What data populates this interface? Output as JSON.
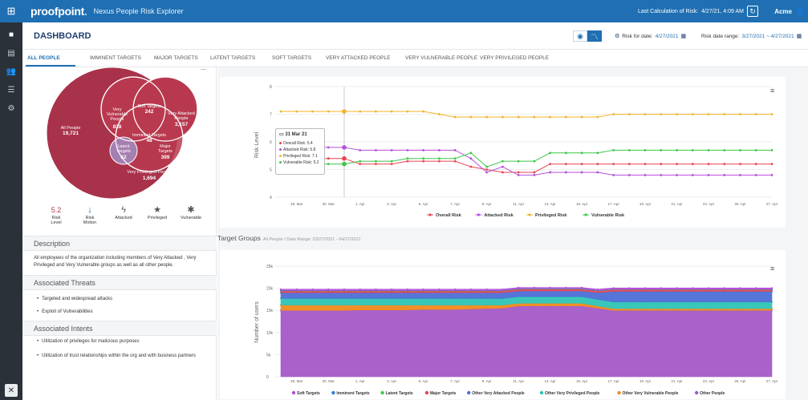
{
  "topbar": {
    "brand": "proofpoint",
    "app_title": "Nexus People Risk Explorer",
    "last_calc": "Last Calculation of Risk:",
    "last_calc_value": "4/27/21, 4:09 AM",
    "org": "Acme"
  },
  "header": {
    "title": "DASHBOARD",
    "risk_for_label": "Risk for date:",
    "risk_for_value": "4/27/2021",
    "risk_range_label": "Risk date range:",
    "risk_range_value": "3/27/2021 ~ 4/27/2021"
  },
  "tabs": [
    {
      "label": "ALL PEOPLE"
    },
    {
      "label": "IMMINENT TARGETS"
    },
    {
      "label": "MAJOR TARGETS"
    },
    {
      "label": "LATENT TARGETS"
    },
    {
      "label": "SOFT TARGETS"
    },
    {
      "label": "VERY ATTACKED PEOPLE"
    },
    {
      "label": "VERY VULNERABLE PEOPLE"
    },
    {
      "label": "VERY PRIVILEGED PEOPLE"
    }
  ],
  "venn": {
    "all": {
      "label": "All People",
      "value": "19,721"
    },
    "soft": {
      "label": "Soft Targets",
      "value": "242"
    },
    "vulnerable": {
      "label": "Very Vulnerable People",
      "value": "838"
    },
    "attacked": {
      "label": "Very Attacked People",
      "value": "3,157"
    },
    "imminent": {
      "label": "Imminent Targets",
      "value": "48"
    },
    "latent": {
      "label": "Latent Targets",
      "value": "62"
    },
    "major": {
      "label": "Major Targets",
      "value": "399"
    },
    "privileged": {
      "label": "Very Privileged People",
      "value": "1,694"
    }
  },
  "legend": {
    "risk_level_value": "5.2",
    "risk_level": "Risk Level",
    "risk_motion": "Risk Motion",
    "attacked": "Attacked",
    "privileged": "Privileged",
    "vulnerable": "Vulnerable"
  },
  "description": {
    "title": "Description",
    "text": "All employees of the organization including members of Very Attacked , Very Privileged and Very Vulnerable groups as well as all other people."
  },
  "threats": {
    "title": "Associated Threats",
    "items": [
      "Targeted and widespread attacks",
      "Exploit of Vulnerabilities"
    ]
  },
  "intents": {
    "title": "Associated Intents",
    "items": [
      "Utilization of privileges for malicious purposes",
      "Utilization of trust relationships within the org and with business partners"
    ]
  },
  "tooltip": {
    "date": "31 Mar 21",
    "rows": [
      "Overall Risk: 5.4",
      "Attacked Risk: 5.8",
      "Privileged Risk: 7.1",
      "Vulnerable Risk: 5.2"
    ]
  },
  "target_groups": {
    "title": "Target Groups",
    "subtitle": "All People / Date Range: 03/27/2021 - 04/27/2021"
  },
  "colors": {
    "overall": "#e84552",
    "attacked": "#b54fdb",
    "privileged": "#f0b429",
    "vulnerable": "#3ec74a",
    "brand": "#1f6fb2"
  },
  "chart_data": [
    {
      "type": "line",
      "title": "",
      "xlabel": "",
      "ylabel": "Risk Level",
      "ylim": [
        4,
        8
      ],
      "yticks": [
        4,
        5,
        6,
        7,
        8
      ],
      "xtick_labels": [
        "28. Mar",
        "30. Mar",
        "1. Apr",
        "3. Apr",
        "5. Apr",
        "7. Apr",
        "9. Apr",
        "11. Apr",
        "13. Apr",
        "15. Apr",
        "17. Apr",
        "19. Apr",
        "21. Apr",
        "23. Apr",
        "25. Apr",
        "27. Apr"
      ],
      "x": [
        "27. Mar",
        "28. Mar",
        "29. Mar",
        "30. Mar",
        "31. Mar",
        "1. Apr",
        "2. Apr",
        "3. Apr",
        "4. Apr",
        "5. Apr",
        "6. Apr",
        "7. Apr",
        "8. Apr",
        "9. Apr",
        "10. Apr",
        "11. Apr",
        "12. Apr",
        "13. Apr",
        "14. Apr",
        "15. Apr",
        "16. Apr",
        "17. Apr",
        "18. Apr",
        "19. Apr",
        "20. Apr",
        "21. Apr",
        "22. Apr",
        "23. Apr",
        "24. Apr",
        "25. Apr",
        "26. Apr",
        "27. Apr"
      ],
      "series": [
        {
          "name": "Overall Risk",
          "values": [
            5.4,
            5.4,
            5.4,
            5.4,
            5.4,
            5.2,
            5.2,
            5.2,
            5.3,
            5.3,
            5.3,
            5.3,
            5.1,
            5.0,
            4.9,
            4.9,
            4.9,
            5.2,
            5.2,
            5.2,
            5.2,
            5.2,
            5.2,
            5.2,
            5.2,
            5.2,
            5.2,
            5.2,
            5.2,
            5.2,
            5.2,
            5.2
          ]
        },
        {
          "name": "Attacked Risk",
          "values": [
            5.8,
            5.8,
            5.8,
            5.8,
            5.8,
            5.7,
            5.7,
            5.7,
            5.7,
            5.7,
            5.7,
            5.7,
            5.4,
            4.9,
            5.1,
            4.8,
            4.8,
            4.9,
            4.9,
            4.9,
            4.9,
            4.8,
            4.8,
            4.8,
            4.8,
            4.8,
            4.8,
            4.8,
            4.8,
            4.8,
            4.8,
            4.8
          ]
        },
        {
          "name": "Privileged Risk",
          "values": [
            7.1,
            7.1,
            7.1,
            7.1,
            7.1,
            7.1,
            7.1,
            7.1,
            7.1,
            7.1,
            7.0,
            6.9,
            6.9,
            6.9,
            6.9,
            6.9,
            6.9,
            6.9,
            6.9,
            6.9,
            6.9,
            7.0,
            7.0,
            7.0,
            7.0,
            7.0,
            7.0,
            7.0,
            7.0,
            7.0,
            7.0,
            7.0
          ]
        },
        {
          "name": "Vulnerable Risk",
          "values": [
            5.2,
            5.2,
            5.2,
            5.2,
            5.2,
            5.3,
            5.3,
            5.3,
            5.4,
            5.4,
            5.4,
            5.4,
            5.6,
            5.1,
            5.3,
            5.3,
            5.3,
            5.6,
            5.6,
            5.6,
            5.6,
            5.7,
            5.7,
            5.7,
            5.7,
            5.7,
            5.7,
            5.7,
            5.7,
            5.7,
            5.7,
            5.7
          ]
        }
      ]
    },
    {
      "type": "area",
      "title": "",
      "xlabel": "",
      "ylabel": "Number of users",
      "ylim": [
        0,
        25000
      ],
      "ytick_labels": [
        "0",
        "5k",
        "10k",
        "15k",
        "20k",
        "25k"
      ],
      "xtick_labels": [
        "28. Mar",
        "30. Mar",
        "1. Apr",
        "3. Apr",
        "5. Apr",
        "7. Apr",
        "9. Apr",
        "11. Apr",
        "13. Apr",
        "15. Apr",
        "17. Apr",
        "19. Apr",
        "21. Apr",
        "23. Apr",
        "25. Apr",
        "27. Apr"
      ],
      "x_count": 32,
      "series": [
        {
          "name": "Other People",
          "values": [
            15000,
            15000,
            15000,
            15000,
            15000,
            15100,
            15100,
            15100,
            15100,
            15200,
            15200,
            15200,
            15300,
            15400,
            15500,
            16000,
            16000,
            16000,
            16000,
            16000,
            15500,
            15000,
            15000,
            15000,
            15000,
            15000,
            15000,
            15000,
            15000,
            15000,
            15000,
            15000
          ]
        },
        {
          "name": "Other Very Vulnerable People",
          "values": [
            1200,
            1200,
            1200,
            1200,
            1200,
            1100,
            1100,
            1100,
            1100,
            1000,
            1000,
            1000,
            900,
            800,
            700,
            600,
            600,
            600,
            600,
            600,
            500,
            400,
            400,
            400,
            400,
            400,
            400,
            400,
            400,
            400,
            400,
            400
          ]
        },
        {
          "name": "Other Very Privileged People",
          "values": [
            1500,
            1500,
            1500,
            1500,
            1500,
            1500,
            1500,
            1500,
            1500,
            1500,
            1500,
            1500,
            1500,
            1500,
            1500,
            1500,
            1500,
            1500,
            1500,
            1500,
            1500,
            1500,
            1500,
            1500,
            1500,
            1500,
            1500,
            1500,
            1500,
            1500,
            1500,
            1500
          ]
        },
        {
          "name": "Other Very Attacked People",
          "values": [
            1300,
            1300,
            1300,
            1300,
            1300,
            1300,
            1300,
            1300,
            1300,
            1300,
            1300,
            1300,
            1300,
            1300,
            1300,
            1300,
            1300,
            1300,
            1300,
            1300,
            1500,
            2400,
            2400,
            2400,
            2400,
            2400,
            2400,
            2400,
            2400,
            2400,
            2400,
            2400
          ]
        },
        {
          "name": "Major Targets",
          "values": [
            399,
            399,
            399,
            399,
            399,
            399,
            399,
            399,
            399,
            399,
            399,
            399,
            399,
            399,
            399,
            399,
            399,
            399,
            399,
            399,
            399,
            399,
            399,
            399,
            399,
            399,
            399,
            399,
            399,
            399,
            399,
            399
          ]
        },
        {
          "name": "Latent Targets",
          "values": [
            62,
            62,
            62,
            62,
            62,
            62,
            62,
            62,
            62,
            62,
            62,
            62,
            62,
            62,
            62,
            62,
            62,
            62,
            62,
            62,
            62,
            62,
            62,
            62,
            62,
            62,
            62,
            62,
            62,
            62,
            62,
            62
          ]
        },
        {
          "name": "Imminent Targets",
          "values": [
            48,
            48,
            48,
            48,
            48,
            48,
            48,
            48,
            48,
            48,
            48,
            48,
            48,
            48,
            48,
            48,
            48,
            48,
            48,
            48,
            48,
            48,
            48,
            48,
            48,
            48,
            48,
            48,
            48,
            48,
            48,
            48
          ]
        },
        {
          "name": "Soft Targets",
          "values": [
            242,
            242,
            242,
            242,
            242,
            242,
            242,
            242,
            242,
            242,
            242,
            242,
            242,
            242,
            242,
            242,
            242,
            242,
            242,
            242,
            242,
            242,
            242,
            242,
            242,
            242,
            242,
            242,
            242,
            242,
            242,
            242
          ]
        }
      ],
      "series_colors": [
        "#a35ac7",
        "#f08a1c",
        "#2ec4b6",
        "#4c6fd6",
        "#e84552",
        "#3ec74a",
        "#2f7fc8",
        "#b54fdb"
      ],
      "legend": [
        "Soft Targets",
        "Imminent Targets",
        "Latent Targets",
        "Major Targets",
        "Other Very Attacked People",
        "Other Very Privileged People",
        "Other Very Vulnerable People",
        "Other People"
      ],
      "legend_colors": [
        "#b54fdb",
        "#2f7fc8",
        "#3ec74a",
        "#e84552",
        "#4c6fd6",
        "#2ec4b6",
        "#f08a1c",
        "#a35ac7"
      ]
    }
  ]
}
